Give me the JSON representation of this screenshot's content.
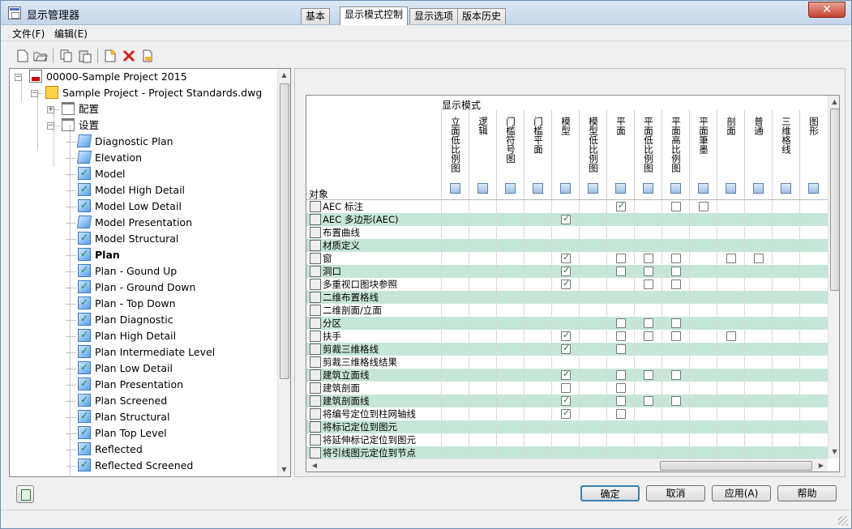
{
  "window": {
    "title": "显示管理器"
  },
  "menu": [
    "文件(F)",
    "编辑(E)"
  ],
  "toolbar": [
    "new-icon",
    "open-icon",
    "copy-icon",
    "paste-icon",
    "new-display-set-icon",
    "delete-icon",
    "purge-icon"
  ],
  "tree": [
    {
      "label": "00000-Sample Project 2015",
      "level": 0,
      "icon": "file"
    },
    {
      "label": "Sample Project - Project Standards.dwg",
      "level": 1,
      "icon": "dwg"
    },
    {
      "label": "配置",
      "level": 2,
      "icon": "folder"
    },
    {
      "label": "设置",
      "level": 2,
      "icon": "folder"
    },
    {
      "label": "Diagnostic Plan",
      "level": 3,
      "icon": "blue"
    },
    {
      "label": "Elevation",
      "level": 3,
      "icon": "blue"
    },
    {
      "label": "Model",
      "level": 3,
      "icon": "check"
    },
    {
      "label": "Model High Detail",
      "level": 3,
      "icon": "check"
    },
    {
      "label": "Model Low Detail",
      "level": 3,
      "icon": "check"
    },
    {
      "label": "Model Presentation",
      "level": 3,
      "icon": "blue"
    },
    {
      "label": "Model Structural",
      "level": 3,
      "icon": "check"
    },
    {
      "label": "Plan",
      "level": 3,
      "icon": "check",
      "bold": true
    },
    {
      "label": "Plan - Gound Up",
      "level": 3,
      "icon": "check"
    },
    {
      "label": "Plan - Ground Down",
      "level": 3,
      "icon": "check"
    },
    {
      "label": "Plan - Top Down",
      "level": 3,
      "icon": "check"
    },
    {
      "label": "Plan Diagnostic",
      "level": 3,
      "icon": "check"
    },
    {
      "label": "Plan High Detail",
      "level": 3,
      "icon": "check"
    },
    {
      "label": "Plan Intermediate Level",
      "level": 3,
      "icon": "check"
    },
    {
      "label": "Plan Low Detail",
      "level": 3,
      "icon": "check"
    },
    {
      "label": "Plan Presentation",
      "level": 3,
      "icon": "check"
    },
    {
      "label": "Plan Screened",
      "level": 3,
      "icon": "check"
    },
    {
      "label": "Plan Structural",
      "level": 3,
      "icon": "check"
    },
    {
      "label": "Plan Top Level",
      "level": 3,
      "icon": "check"
    },
    {
      "label": "Reflected",
      "level": 3,
      "icon": "check"
    },
    {
      "label": "Reflected Screened",
      "level": 3,
      "icon": "check"
    }
  ],
  "tabs": [
    {
      "label": "基本"
    },
    {
      "label": "显示模式控制",
      "active": true
    },
    {
      "label": "显示选项"
    },
    {
      "label": "版本历史"
    }
  ],
  "grid": {
    "header_top": "显示模式",
    "header_object": "对象",
    "columns": [
      "立面低比例图",
      "逻辑",
      "门槛符号图",
      "门槛平面",
      "模型",
      "模型低比例图",
      "平面",
      "平面低比例图",
      "平面高比例图",
      "平面筆墨",
      "剖面",
      "普通",
      "三维格线",
      "图形"
    ],
    "rows": [
      {
        "label": "AEC 标注",
        "cells": "------c-uu----"
      },
      {
        "label": "AEC 多边形(AEC)",
        "cells": "----c---------"
      },
      {
        "label": "布置曲线",
        "cells": "--------------"
      },
      {
        "label": "材质定义",
        "cells": "--------------"
      },
      {
        "label": "窗",
        "cells": "----c-uuu-uu--"
      },
      {
        "label": "洞口",
        "cells": "----c-uuu-----"
      },
      {
        "label": "多重视口图块参照",
        "cells": "----c--uu-----"
      },
      {
        "label": "二维布置格线",
        "cells": "--------------"
      },
      {
        "label": "二维剖面/立面",
        "cells": "--------------"
      },
      {
        "label": "分区",
        "cells": "------uuu-----"
      },
      {
        "label": "扶手",
        "cells": "----c-uuu-u---"
      },
      {
        "label": "剪裁三维格线",
        "cells": "----c-u-------"
      },
      {
        "label": "剪裁三维格线结果",
        "cells": "--------------"
      },
      {
        "label": "建筑立面线",
        "cells": "----c-uuu-----"
      },
      {
        "label": "建筑剖面",
        "cells": "----u-u-------"
      },
      {
        "label": "建筑剖面线",
        "cells": "----c-uuu-----"
      },
      {
        "label": "将编号定位到柱网轴线",
        "cells": "----c-u-------"
      },
      {
        "label": "将标记定位到图元",
        "cells": "--------------"
      },
      {
        "label": "将延伸标记定位到图元",
        "cells": "--------------"
      },
      {
        "label": "将引线图元定位到节点",
        "cells": "--------------"
      }
    ]
  },
  "buttons": {
    "ok": "确定",
    "cancel": "取消",
    "apply": "应用(A)",
    "help": "帮助"
  }
}
